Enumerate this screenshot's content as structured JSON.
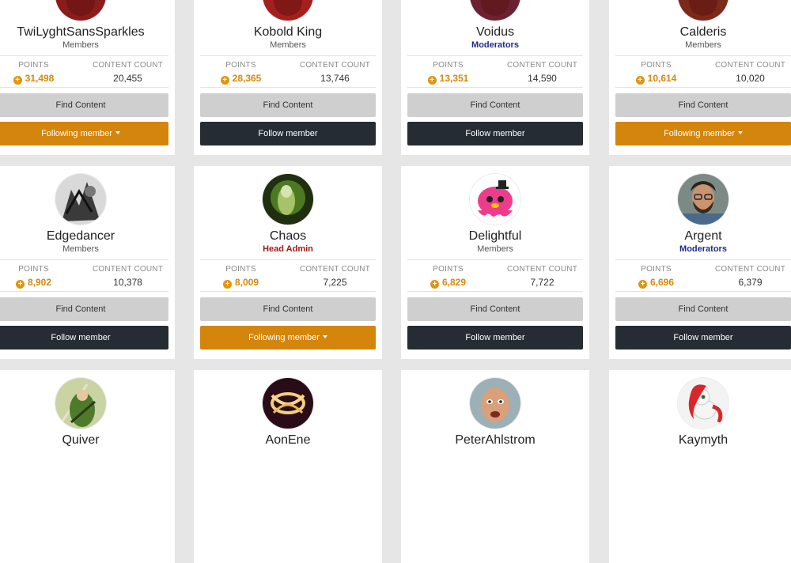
{
  "members": [
    {
      "name": "TwiLyghtSansSparkles",
      "group": "Members",
      "group_type": "member",
      "points_label": "POINTS",
      "points": "31,498",
      "content_label": "CONTENT COUNT",
      "content": "20,455",
      "find_label": "Find Content",
      "follow_label": "Following member",
      "following": true,
      "avatar": "partial-avatar",
      "avatar_color": "#8a1c1c"
    },
    {
      "name": "Kobold King",
      "group": "Members",
      "group_type": "member",
      "points_label": "POINTS",
      "points": "28,365",
      "content_label": "CONTENT COUNT",
      "content": "13,746",
      "find_label": "Find Content",
      "follow_label": "Follow member",
      "following": false,
      "avatar": "partial-avatar",
      "avatar_color": "#a4201e"
    },
    {
      "name": "Voidus",
      "group": "Moderators",
      "group_type": "mod",
      "points_label": "POINTS",
      "points": "13,351",
      "content_label": "CONTENT COUNT",
      "content": "14,590",
      "find_label": "Find Content",
      "follow_label": "Follow member",
      "following": false,
      "avatar": "partial-avatar",
      "avatar_color": "#6b2230"
    },
    {
      "name": "Calderis",
      "group": "Members",
      "group_type": "member",
      "points_label": "POINTS",
      "points": "10,614",
      "content_label": "CONTENT COUNT",
      "content": "10,020",
      "find_label": "Find Content",
      "follow_label": "Following member",
      "following": true,
      "avatar": "partial-avatar",
      "avatar_color": "#7a2a1a"
    },
    {
      "name": "Edgedancer",
      "group": "Members",
      "group_type": "member",
      "points_label": "POINTS",
      "points": "8,902",
      "content_label": "CONTENT COUNT",
      "content": "10,378",
      "find_label": "Find Content",
      "follow_label": "Follow member",
      "following": false,
      "avatar": "sketch-avatar",
      "avatar_color": "#555555"
    },
    {
      "name": "Chaos",
      "group": "Head Admin",
      "group_type": "admin",
      "points_label": "POINTS",
      "points": "8,009",
      "content_label": "CONTENT COUNT",
      "content": "7,225",
      "find_label": "Find Content",
      "follow_label": "Following member",
      "following": true,
      "avatar": "green-figure-avatar",
      "avatar_color": "#3a5a1e"
    },
    {
      "name": "Delightful",
      "group": "Members",
      "group_type": "member",
      "points_label": "POINTS",
      "points": "6,829",
      "content_label": "CONTENT COUNT",
      "content": "7,722",
      "find_label": "Find Content",
      "follow_label": "Follow member",
      "following": false,
      "avatar": "pink-octopus-avatar",
      "avatar_color": "#ee3c8c"
    },
    {
      "name": "Argent",
      "group": "Moderators",
      "group_type": "mod",
      "points_label": "POINTS",
      "points": "6,696",
      "content_label": "CONTENT COUNT",
      "content": "6,379",
      "find_label": "Find Content",
      "follow_label": "Follow member",
      "following": false,
      "avatar": "bearded-man-avatar",
      "avatar_color": "#6b4a36"
    },
    {
      "name": "Quiver",
      "group": "",
      "group_type": "member",
      "avatar": "green-archer-avatar",
      "avatar_color": "#5a7a2a"
    },
    {
      "name": "AonEne",
      "group": "",
      "group_type": "member",
      "avatar": "glowing-symbol-avatar",
      "avatar_color": "#4a1230"
    },
    {
      "name": "PeterAhlstrom",
      "group": "",
      "group_type": "member",
      "avatar": "face-photo-avatar",
      "avatar_color": "#c9906a"
    },
    {
      "name": "Kaymyth",
      "group": "",
      "group_type": "member",
      "avatar": "red-pony-avatar",
      "avatar_color": "#d8262a"
    }
  ],
  "colors": {
    "accent_orange": "#d4850c",
    "follow_dark": "#262c33",
    "moderator_blue": "#1d2c8f",
    "admin_red": "#a11a1a",
    "points_orange": "#d4890b"
  }
}
